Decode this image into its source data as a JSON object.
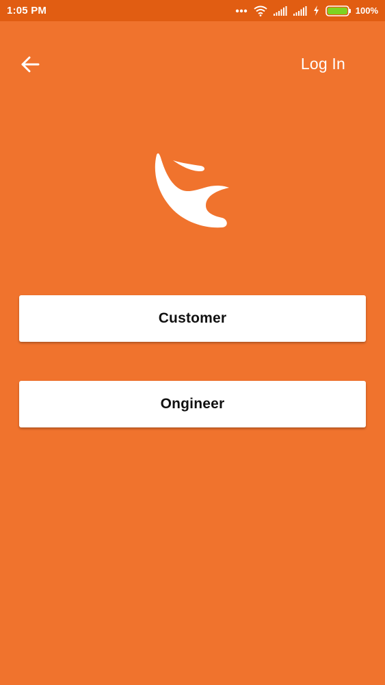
{
  "status_bar": {
    "time": "1:05 PM",
    "battery_percent": "100%",
    "icons": [
      "more-dots-icon",
      "wifi-icon",
      "signal-icon",
      "signal-icon",
      "charging-bolt-icon",
      "battery-icon"
    ]
  },
  "header": {
    "back_icon": "arrow-left-icon",
    "login_label": "Log In"
  },
  "logo": {
    "icon": "brand-figure-logo"
  },
  "roles": {
    "customer_label": "Customer",
    "ongineer_label": "Ongineer"
  },
  "colors": {
    "background": "#f0732d",
    "status_bar": "#e15d12",
    "button": "#ffffff",
    "battery_fill": "#7ed321"
  }
}
